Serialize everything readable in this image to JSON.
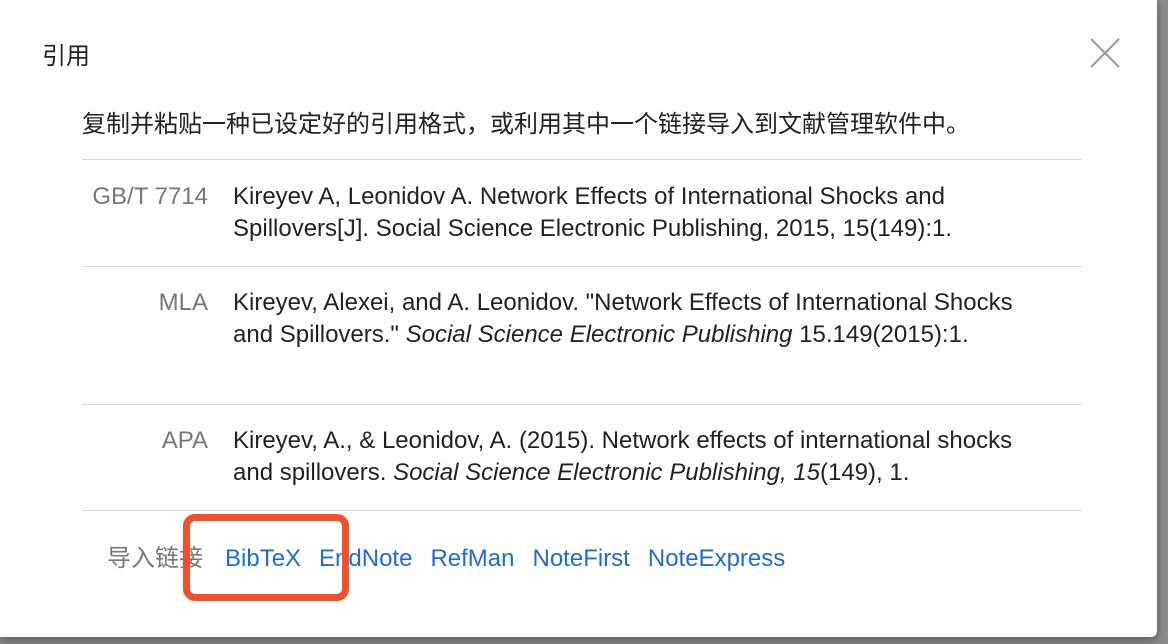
{
  "dialog": {
    "title": "引用",
    "intro": "复制并粘贴一种已设定好的引用格式，或利用其中一个链接导入到文献管理软件中。",
    "close_icon": "close-icon"
  },
  "citations": [
    {
      "label": "GB/T 7714",
      "parts": [
        {
          "text": "Kireyev A, Leonidov A. Network Effects of International Shocks and Spillovers[J]. Social Science Electronic Publishing, 2015, 15(149):1.",
          "italic": false
        }
      ]
    },
    {
      "label": "MLA",
      "parts": [
        {
          "text": "Kireyev, Alexei, and A. Leonidov. \"Network Effects of International Shocks and Spillovers.\" ",
          "italic": false
        },
        {
          "text": "Social Science Electronic Publishing",
          "italic": true
        },
        {
          "text": " 15.149(2015):1.",
          "italic": false
        }
      ]
    },
    {
      "label": "APA",
      "parts": [
        {
          "text": "Kireyev, A., & Leonidov, A. (2015). Network effects of international shocks and spillovers. ",
          "italic": false
        },
        {
          "text": "Social Science Electronic Publishing, 15",
          "italic": true
        },
        {
          "text": "(149), 1.",
          "italic": false
        }
      ]
    }
  ],
  "import": {
    "label": "导入链接",
    "links": [
      "BibTeX",
      "EndNote",
      "RefMan",
      "NoteFirst",
      "NoteExpress"
    ]
  },
  "colors": {
    "link": "#1f6bd6",
    "highlight": "#f0512c",
    "label_gray": "#777777"
  }
}
